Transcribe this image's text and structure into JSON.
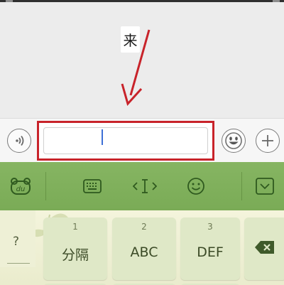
{
  "chat": {
    "message": "来"
  },
  "input_bar": {
    "voice_icon": "voice-waves-icon",
    "text_value": "",
    "emoji_icon": "smiley-face-icon",
    "plus_icon": "plus-icon",
    "highlight_color": "#c8232a"
  },
  "toolbar": {
    "items": [
      {
        "icon": "du-bear-logo-icon"
      },
      {
        "icon": "keyboard-icon"
      },
      {
        "icon": "cursor-move-icon"
      },
      {
        "icon": "smiley-icon"
      },
      {
        "icon": "collapse-keyboard-icon"
      }
    ],
    "color": "#7aab56"
  },
  "keyboard": {
    "symbol_key": "?",
    "keys": [
      {
        "num": "1",
        "label": "分隔"
      },
      {
        "num": "2",
        "label": "ABC"
      },
      {
        "num": "3",
        "label": "DEF"
      }
    ],
    "delete_icon": "backspace-icon"
  }
}
